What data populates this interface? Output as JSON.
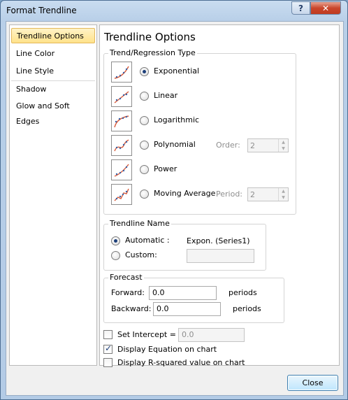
{
  "window": {
    "title": "Format Trendline"
  },
  "title_buttons": {
    "help": "?",
    "close": "✕"
  },
  "nav": {
    "items": [
      {
        "label": "Trendline Options",
        "selected": true
      },
      {
        "label": "Line Color"
      },
      {
        "label": "Line Style"
      },
      {
        "label": "Shadow"
      },
      {
        "label": "Glow and Soft Edges"
      }
    ]
  },
  "panel": {
    "title": "Trendline Options",
    "regression": {
      "legend": "Trend/Regression Type",
      "types": [
        {
          "label": "Exponential",
          "icon": "exponential-trend-icon",
          "checked": true
        },
        {
          "label": "Linear",
          "icon": "linear-trend-icon",
          "checked": false
        },
        {
          "label": "Logarithmic",
          "icon": "logarithmic-trend-icon",
          "checked": false
        },
        {
          "label": "Polynomial",
          "icon": "polynomial-trend-icon",
          "checked": false
        },
        {
          "label": "Power",
          "icon": "power-trend-icon",
          "checked": false
        },
        {
          "label": "Moving Average",
          "icon": "moving-average-trend-icon",
          "checked": false
        }
      ],
      "order_label": "Order:",
      "order_value": "2",
      "period_label": "Period:",
      "period_value": "2"
    },
    "name": {
      "legend": "Trendline Name",
      "automatic_label": "Automatic :",
      "automatic_value": "Expon. (Series1)",
      "custom_label": "Custom:",
      "custom_value": ""
    },
    "forecast": {
      "legend": "Forecast",
      "forward_label": "Forward:",
      "forward_value": "0.0",
      "forward_unit": "periods",
      "backward_label": "Backward:",
      "backward_value": "0.0",
      "backward_unit": "periods"
    },
    "set_intercept_label": "Set Intercept =",
    "set_intercept_value": "0.0",
    "display_equation_label": "Display Equation on chart",
    "display_rsquared_label": "Display R-squared value on chart"
  },
  "footer": {
    "close_label": "Close"
  },
  "colors": {
    "accent": "#1d3f7a",
    "selection": "#ffe28a",
    "trend_line": "#d85a3a",
    "dots": "#3a63a8"
  }
}
